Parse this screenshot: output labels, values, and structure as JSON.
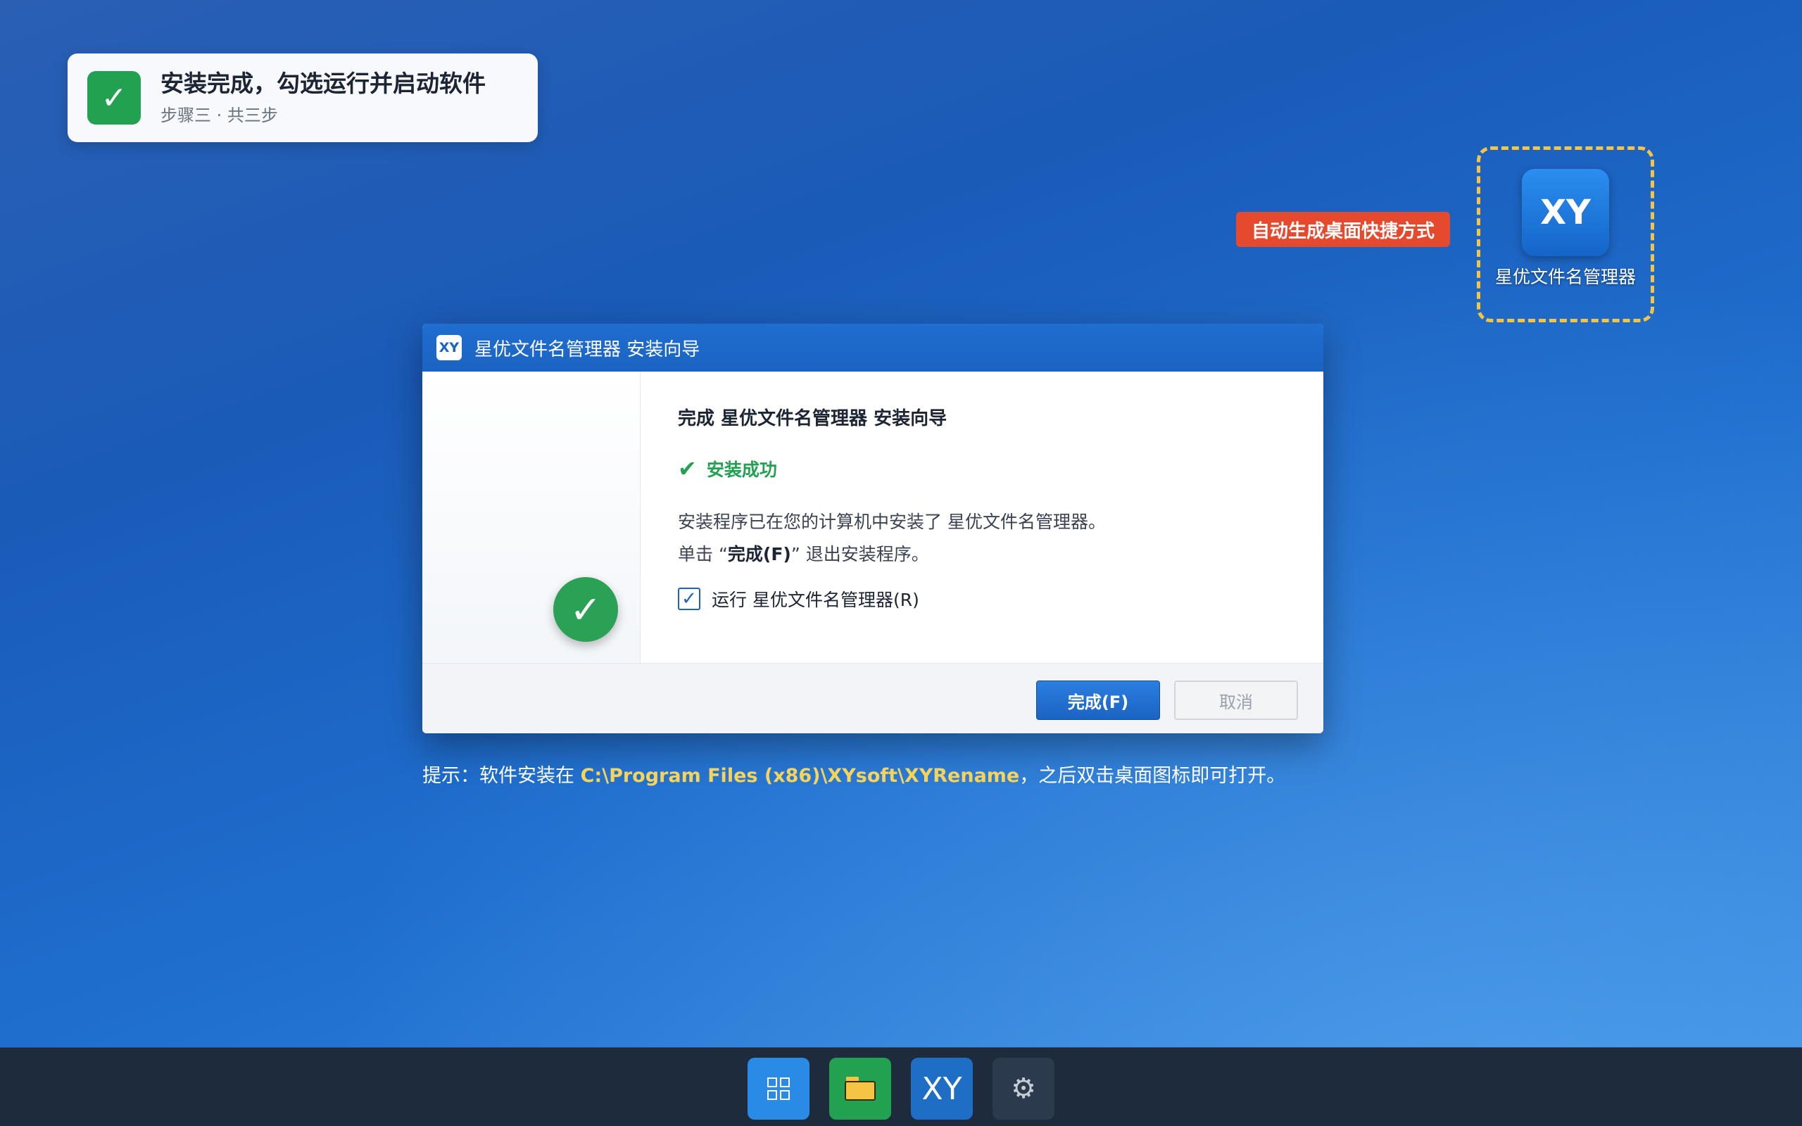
{
  "step_banner": {
    "title": "安装完成，勾选运行并启动软件",
    "subtitle": "步骤三 · 共三步"
  },
  "desktop_shortcut": {
    "tag": "自动生成桌面快捷方式",
    "icon_text": "XY",
    "label": "星优文件名管理器"
  },
  "installer": {
    "badge": "XY",
    "title": "星优文件名管理器 安装向导",
    "heading": "完成 星优文件名管理器 安装向导",
    "success_text": "安装成功",
    "desc_line1": "安装程序已在您的计算机中安装了 星优文件名管理器。",
    "desc_line2_prefix": "单击 “",
    "desc_line2_bold": "完成(F)",
    "desc_line2_suffix": "” 退出安装程序。",
    "run_checkbox_label": "运行 星优文件名管理器(R)",
    "run_checked": true,
    "finish_button": "完成(F)",
    "cancel_button": "取消",
    "close_glyph": "✕"
  },
  "hint": {
    "prefix": "提示：软件安装在 ",
    "path": "C:\\Program Files (x86)\\XYsoft\\XYRename",
    "suffix": "，之后双击桌面图标即可打开。"
  },
  "taskbar": {
    "app_text": "XY",
    "settings_glyph": "⚙",
    "icons": [
      "start-icon",
      "folder-icon",
      "xy-app-icon",
      "settings-icon"
    ]
  },
  "colors": {
    "accent_blue": "#1b63c2",
    "success_green": "#22a150",
    "tag_red": "#e64a2e",
    "dashed_yellow": "#f4c445",
    "path_yellow": "#f6d35a"
  }
}
